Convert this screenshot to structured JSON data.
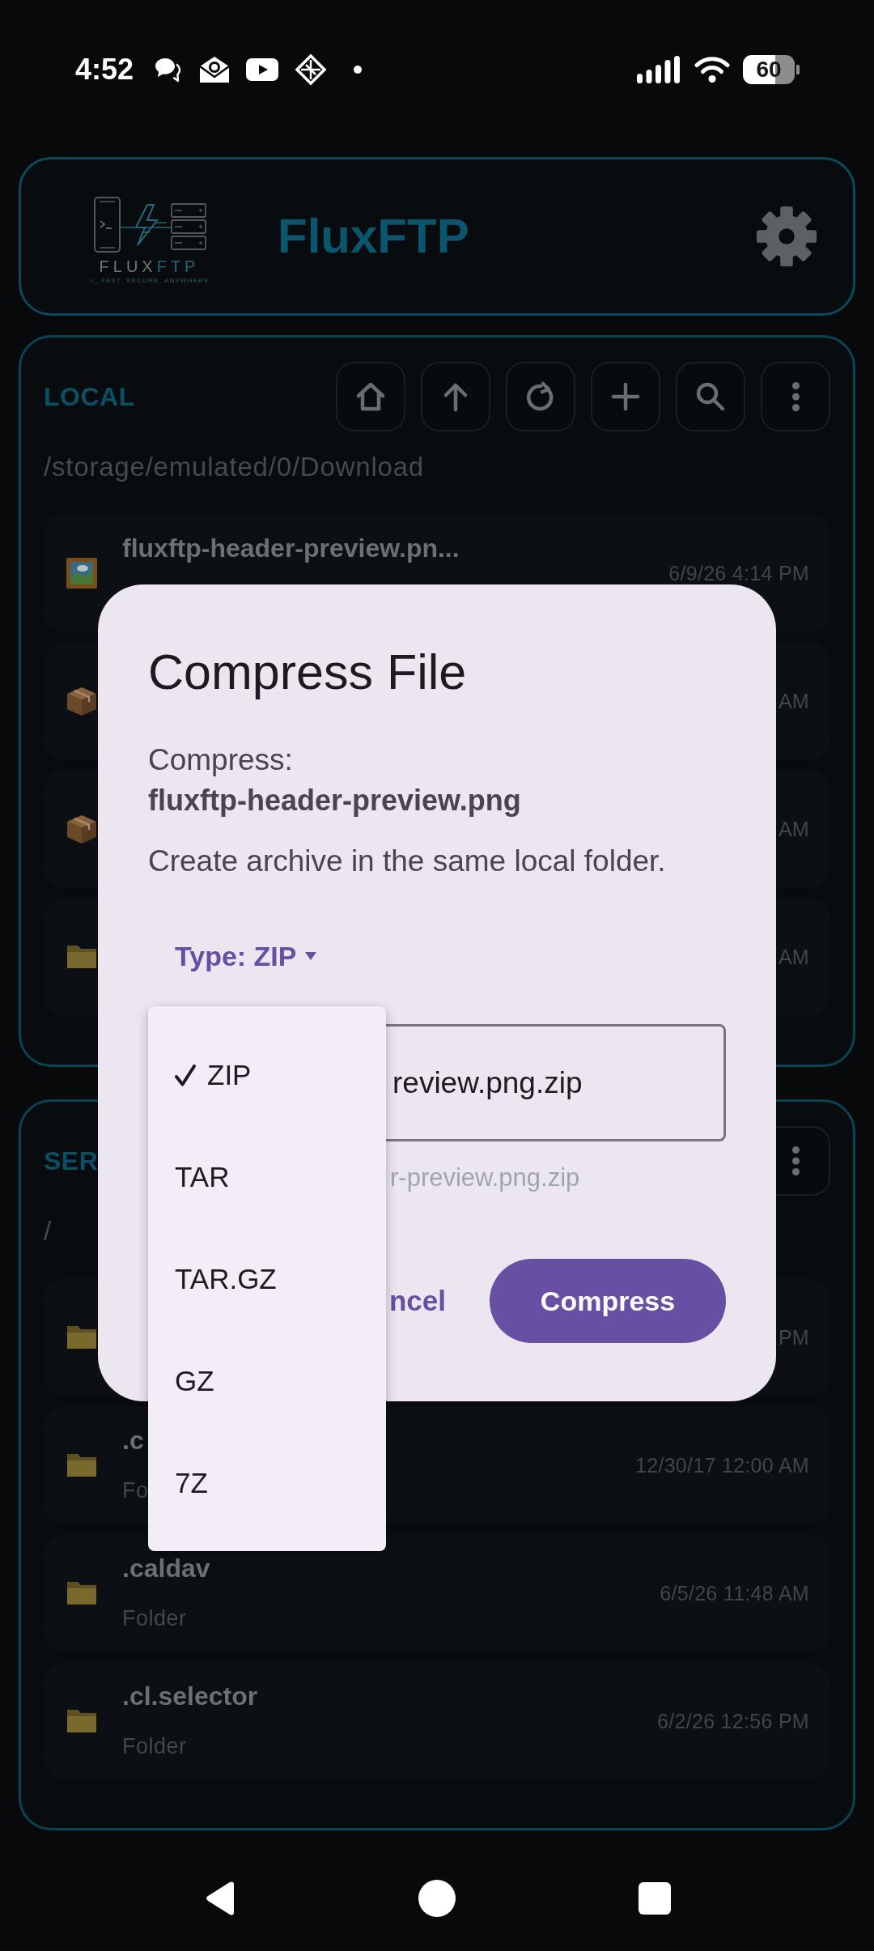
{
  "status_bar": {
    "time": "4:52",
    "battery": "60"
  },
  "header": {
    "logo": {
      "wordmark_part_1": "FLUX",
      "wordmark_part_2": "FTP",
      "tagline": ">_ FAST. SECURE. ANYWHERE"
    },
    "title": "FluxFTP"
  },
  "local": {
    "title": "LOCAL",
    "path": "/storage/emulated/0/Download",
    "files": [
      {
        "kind": "image",
        "name": "fluxftp-header-preview.pn...",
        "date": "6/9/26 4:14 PM"
      },
      {
        "kind": "archive",
        "date": "AM"
      },
      {
        "kind": "archive",
        "date": "AM"
      },
      {
        "kind": "folder",
        "date": "AM"
      }
    ]
  },
  "server": {
    "title": "SER",
    "path": "/",
    "files": [
      {
        "kind": "folder",
        "date": "PM"
      },
      {
        "kind": "folder",
        "name": ".c",
        "detail": "Fo",
        "date": "12/30/17 12:00 AM"
      },
      {
        "kind": "folder",
        "name": ".caldav",
        "detail": "Folder",
        "date": "6/5/26 11:48 AM"
      },
      {
        "kind": "folder",
        "name": ".cl.selector",
        "detail": "Folder",
        "date": "6/2/26 12:56 PM"
      }
    ]
  },
  "dialog": {
    "title": "Compress File",
    "label": "Compress:",
    "file_name": "fluxftp-header-preview.png",
    "description": "Create archive in the same local folder.",
    "type_button": "Type: ZIP",
    "type_menu": [
      {
        "label": "ZIP",
        "selected": true
      },
      {
        "label": "TAR",
        "selected": false
      },
      {
        "label": "TAR.GZ",
        "selected": false
      },
      {
        "label": "GZ",
        "selected": false
      },
      {
        "label": "7Z",
        "selected": false
      }
    ],
    "archive_name_field": {
      "value": "review.png.zip",
      "helper": "r-preview.png.zip"
    },
    "buttons": [
      {
        "kind": "text",
        "label": "ncel"
      },
      {
        "kind": "filled",
        "label": "Compress"
      }
    ]
  }
}
